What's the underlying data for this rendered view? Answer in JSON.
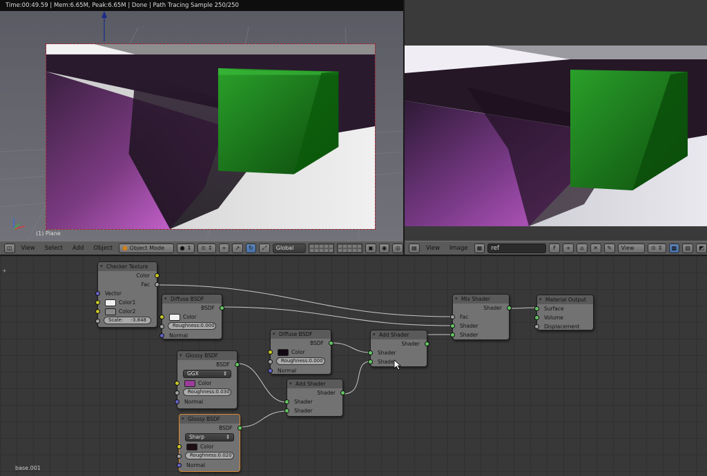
{
  "render_info": "Time:00:49.59 | Mem:6.65M, Peak:6.65M | Done | Path Tracing Sample 250/250",
  "viewport": {
    "object_label": "(1) Plane",
    "menu": [
      "View",
      "Select",
      "Add",
      "Object"
    ],
    "mode": "Object Mode",
    "orientation": "Global"
  },
  "image_editor": {
    "menu": [
      "View",
      "Image"
    ],
    "image_name": "ref",
    "fake_user": "F",
    "view_label": "View"
  },
  "nodes": {
    "checker": {
      "title": "Checker Texture",
      "out_color": "Color",
      "out_fac": "Fac",
      "in_vector": "Vector",
      "color1_label": "Color1",
      "color2_label": "Color2",
      "color1": "#f0f0f0",
      "color2": "#8a8a8a",
      "scale_label": "Scale:",
      "scale_value": "-3.848"
    },
    "diffuse1": {
      "title": "Diffuse BSDF",
      "out": "BSDF",
      "color_label": "Color",
      "color": "#f2f2f2",
      "roughness_label": "Roughness:",
      "roughness_value": "0.000",
      "normal": "Normal"
    },
    "diffuse2": {
      "title": "Diffuse BSDF",
      "out": "BSDF",
      "color_label": "Color",
      "color": "#120812",
      "roughness_label": "Roughness:",
      "roughness_value": "0.000",
      "normal": "Normal"
    },
    "glossy1": {
      "title": "Glossy BSDF",
      "out": "BSDF",
      "distribution": "GGX",
      "color_label": "Color",
      "color": "#9b3c9b",
      "roughness_label": "Roughness:",
      "roughness_value": "0.030",
      "normal": "Normal"
    },
    "glossy2": {
      "title": "Glossy BSDF",
      "out": "BSDF",
      "distribution": "Sharp",
      "color_label": "Color",
      "color": "#1e0e16",
      "roughness_label": "Roughness:",
      "roughness_value": "0.020",
      "normal": "Normal"
    },
    "add1": {
      "title": "Add Shader",
      "out": "Shader",
      "in1": "Shader",
      "in2": "Shader"
    },
    "add2": {
      "title": "Add Shader",
      "out": "Shader",
      "in1": "Shader",
      "in2": "Shader"
    },
    "mix": {
      "title": "Mix Shader",
      "out": "Shader",
      "fac": "Fac",
      "in1": "Shader",
      "in2": "Shader"
    },
    "output": {
      "title": "Material Output",
      "surface": "Surface",
      "volume": "Volume",
      "displacement": "Displacement"
    }
  },
  "material_name": "base.001"
}
